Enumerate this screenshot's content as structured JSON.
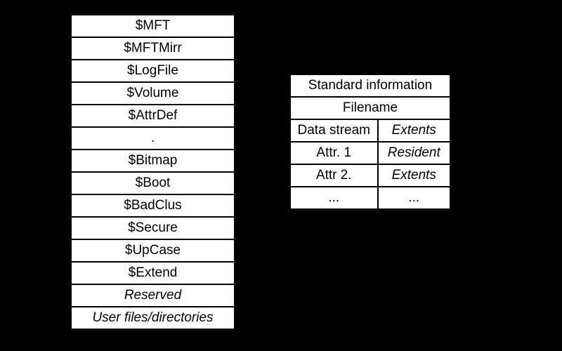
{
  "left": {
    "rows": [
      {
        "label": "$MFT",
        "italic": false
      },
      {
        "label": "$MFTMirr",
        "italic": false
      },
      {
        "label": "$LogFile",
        "italic": false
      },
      {
        "label": "$Volume",
        "italic": false
      },
      {
        "label": "$AttrDef",
        "italic": false
      },
      {
        "label": ".",
        "italic": false
      },
      {
        "label": "$Bitmap",
        "italic": false
      },
      {
        "label": "$Boot",
        "italic": false
      },
      {
        "label": "$BadClus",
        "italic": false
      },
      {
        "label": "$Secure",
        "italic": false
      },
      {
        "label": "$UpCase",
        "italic": false
      },
      {
        "label": "$Extend",
        "italic": false
      },
      {
        "label": "Reserved",
        "italic": true
      },
      {
        "label": "User files/directories",
        "italic": true
      }
    ]
  },
  "right": {
    "header1": "Standard information",
    "header2": "Filename",
    "rows": [
      {
        "left": "Data stream",
        "right": "Extents",
        "rightItalic": true
      },
      {
        "left": "Attr. 1",
        "right": "Resident",
        "rightItalic": true
      },
      {
        "left": "Attr 2.",
        "right": "Extents",
        "rightItalic": true
      },
      {
        "left": "...",
        "right": "...",
        "rightItalic": false
      }
    ]
  }
}
